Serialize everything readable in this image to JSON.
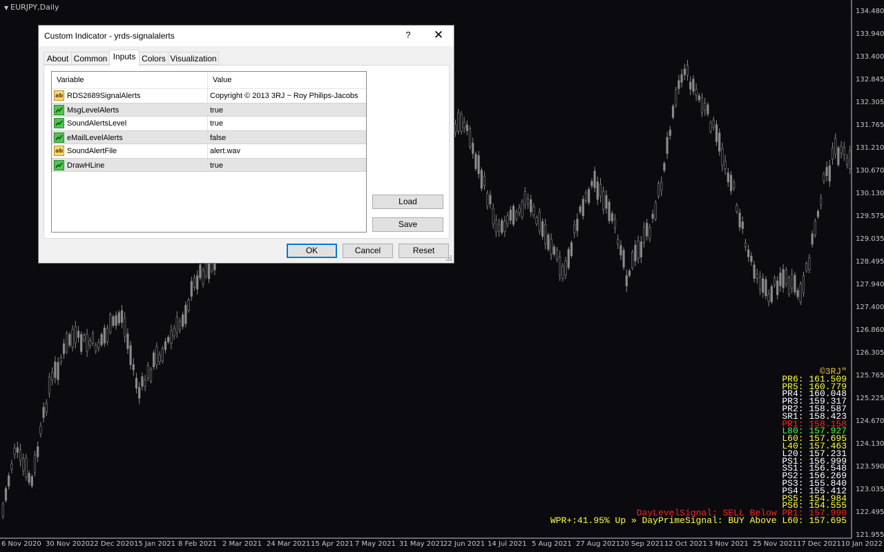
{
  "chart": {
    "symbol_label": "EURJPY,Daily",
    "price_ticks": [
      "134.480",
      "133.940",
      "133.400",
      "132.845",
      "132.305",
      "131.765",
      "131.210",
      "130.670",
      "130.130",
      "129.575",
      "129.035",
      "128.495",
      "127.940",
      "127.400",
      "126.860",
      "126.305",
      "125.765",
      "125.225",
      "124.670",
      "124.130",
      "123.590",
      "123.035",
      "122.495",
      "121.955"
    ],
    "date_ticks": [
      "6 Nov 2020",
      "30 Nov 2020",
      "22 Dec 2020",
      "15 Jan 2021",
      "8 Feb 2021",
      "2 Mar 2021",
      "24 Mar 2021",
      "15 Apr 2021",
      "7 May 2021",
      "31 May 2021",
      "22 Jun 2021",
      "14 Jul 2021",
      "5 Aug 2021",
      "27 Aug 2021",
      "20 Sep 2021",
      "12 Oct 2021",
      "3 Nov 2021",
      "25 Nov 2021",
      "17 Dec 2021",
      "10 Jan 2022"
    ],
    "colors": {
      "background": "#0b0b0f",
      "candle": "#8a8a8a",
      "axis_text": "#c8c8c8"
    }
  },
  "levels": [
    {
      "text": "©3RJ\"",
      "color": "#f0c040"
    },
    {
      "text": "PR6: 161.509",
      "color": "#ffff40"
    },
    {
      "text": "PR5: 160.779",
      "color": "#ffff40"
    },
    {
      "text": "PR4: 160.048",
      "color": "#ffffff"
    },
    {
      "text": "PR3: 159.317",
      "color": "#ffffff"
    },
    {
      "text": "PR2: 158.587",
      "color": "#ffffff"
    },
    {
      "text": "SR1: 158.423",
      "color": "#ffffff"
    },
    {
      "text": "PR1: 158.158",
      "color": "#ff2020"
    },
    {
      "text": "L80: 157.927",
      "color": "#40ff40"
    },
    {
      "text": "L60: 157.695",
      "color": "#ffff40"
    },
    {
      "text": "L40: 157.463",
      "color": "#ffff40"
    },
    {
      "text": "L20: 157.231",
      "color": "#ffffff"
    },
    {
      "text": "PS1: 156.999",
      "color": "#ffffff"
    },
    {
      "text": "SS1: 156.548",
      "color": "#ffffff"
    },
    {
      "text": "PS2: 156.269",
      "color": "#ffffff"
    },
    {
      "text": "PS3: 155.840",
      "color": "#ffffff"
    },
    {
      "text": "PS4: 155.412",
      "color": "#ffffff"
    },
    {
      "text": "PS5: 154.984",
      "color": "#ffff40"
    },
    {
      "text": "PS6: 154.555",
      "color": "#ffff40"
    },
    {
      "text": "DayLevelSignal: SELL Below PR1: 157.990",
      "color": "#ff2020"
    },
    {
      "text": "WPR+:41.95% Up » DayPrimeSignal: BUY Above L60: 157.695",
      "color": "#ffff40"
    }
  ],
  "dialog": {
    "title": "Custom Indicator - yrds-signalalerts",
    "help": "?",
    "close": "✕",
    "tabs": [
      "About",
      "Common",
      "Inputs",
      "Colors",
      "Visualization"
    ],
    "active_tab": "Inputs",
    "grid": {
      "headers": {
        "variable": "Variable",
        "value": "Value"
      },
      "rows": [
        {
          "icon": "string-icon",
          "icon_text": "ab",
          "variable": "RDS2689SignalAlerts",
          "value": "Copyright © 2013 3RJ ~ Roy Philips-Jacobs"
        },
        {
          "icon": "bool-icon",
          "variable": "MsgLevelAlerts",
          "value": "true"
        },
        {
          "icon": "bool-icon",
          "variable": "SoundAlertsLevel",
          "value": "true"
        },
        {
          "icon": "bool-icon",
          "variable": "eMailLevelAlerts",
          "value": "false"
        },
        {
          "icon": "string-icon",
          "icon_text": "ab",
          "variable": "SoundAlertFile",
          "value": "alert.wav"
        },
        {
          "icon": "bool-icon",
          "variable": "DrawHLine",
          "value": "true"
        }
      ]
    },
    "buttons": {
      "load": "Load",
      "save": "Save",
      "ok": "OK",
      "cancel": "Cancel",
      "reset": "Reset"
    }
  }
}
